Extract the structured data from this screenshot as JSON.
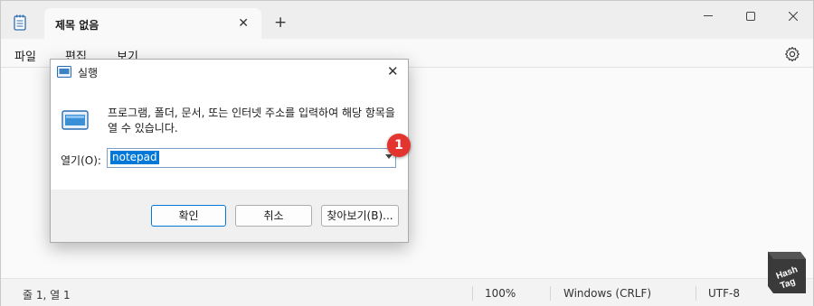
{
  "tab": {
    "title": "제목 없음",
    "close": "✕",
    "new_tab": "+"
  },
  "menu": {
    "file": "파일",
    "edit": "편집",
    "view": "보기"
  },
  "status": {
    "position": "줄 1, 열 1",
    "zoom": "100%",
    "line_ending": "Windows (CRLF)",
    "encoding": "UTF-8"
  },
  "dialog": {
    "title": "실행",
    "close": "✕",
    "description": "프로그램, 폴더, 문서, 또는 인터넷 주소를 입력하여 해당 항목을 열 수 있습니다.",
    "open_label": "열기(O):",
    "input_value": "notepad",
    "ok": "확인",
    "cancel": "취소",
    "browse": "찾아보기(B)..."
  },
  "badge": "1",
  "watermark": {
    "line1": "Hash",
    "line2": "Tag"
  },
  "colors": {
    "accent": "#0078d7",
    "badge": "#e3342f"
  }
}
